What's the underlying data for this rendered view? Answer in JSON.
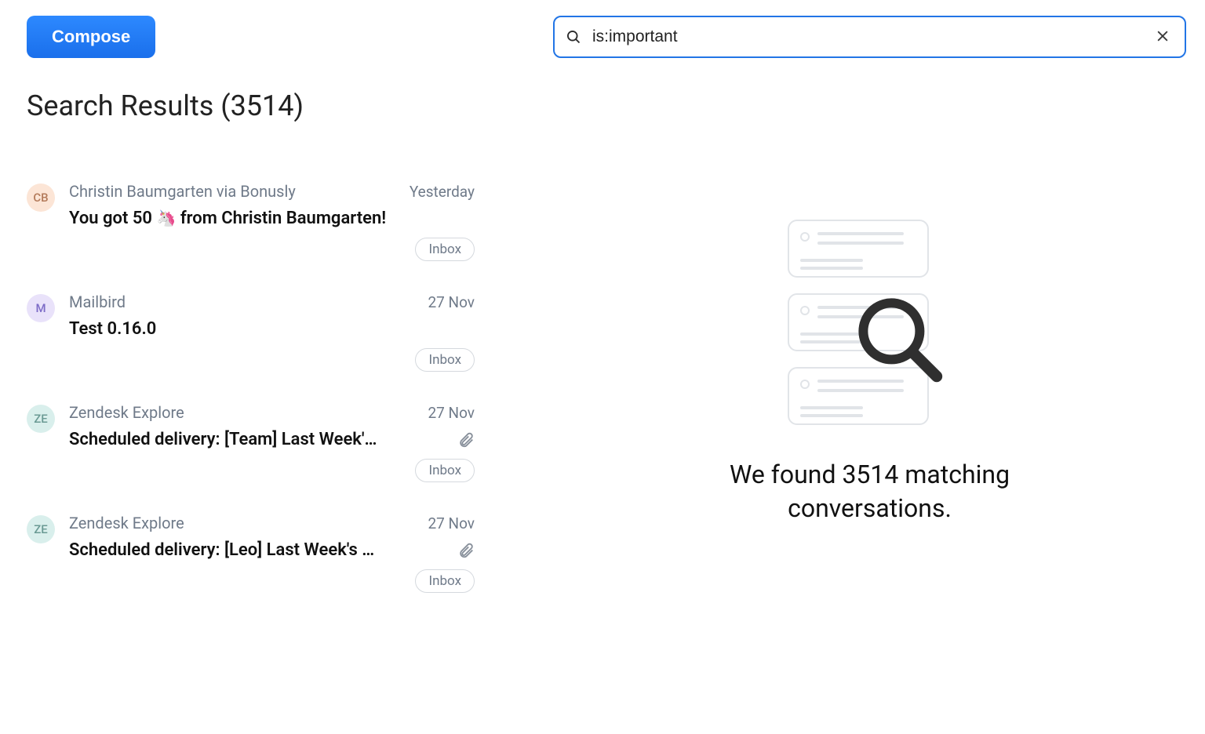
{
  "compose_label": "Compose",
  "search_results_title": "Search Results (3514)",
  "search": {
    "value": "is:important"
  },
  "pane": {
    "message": "We found 3514 matching conversations."
  },
  "emails": [
    {
      "avatar_initials": "CB",
      "avatar_class": "avatar-cb",
      "sender": "Christin Baumgarten via Bonusly",
      "date": "Yesterday",
      "subject_pre": "You got 50 ",
      "subject_emoji": "🦄",
      "subject_post": " from Christin Baumgarten!",
      "has_attachment": false,
      "label": "Inbox"
    },
    {
      "avatar_initials": "M",
      "avatar_class": "avatar-m",
      "sender": "Mailbird",
      "date": "27 Nov",
      "subject_pre": "Test 0.16.0",
      "subject_emoji": "",
      "subject_post": "",
      "has_attachment": false,
      "label": "Inbox"
    },
    {
      "avatar_initials": "ZE",
      "avatar_class": "avatar-ze",
      "sender": "Zendesk Explore",
      "date": "27 Nov",
      "subject_pre": "Scheduled delivery: [Team] Last Week'…",
      "subject_emoji": "",
      "subject_post": "",
      "has_attachment": true,
      "label": "Inbox"
    },
    {
      "avatar_initials": "ZE",
      "avatar_class": "avatar-ze",
      "sender": "Zendesk Explore",
      "date": "27 Nov",
      "subject_pre": "Scheduled delivery: [Leo] Last Week's …",
      "subject_emoji": "",
      "subject_post": "",
      "has_attachment": true,
      "label": "Inbox"
    }
  ]
}
